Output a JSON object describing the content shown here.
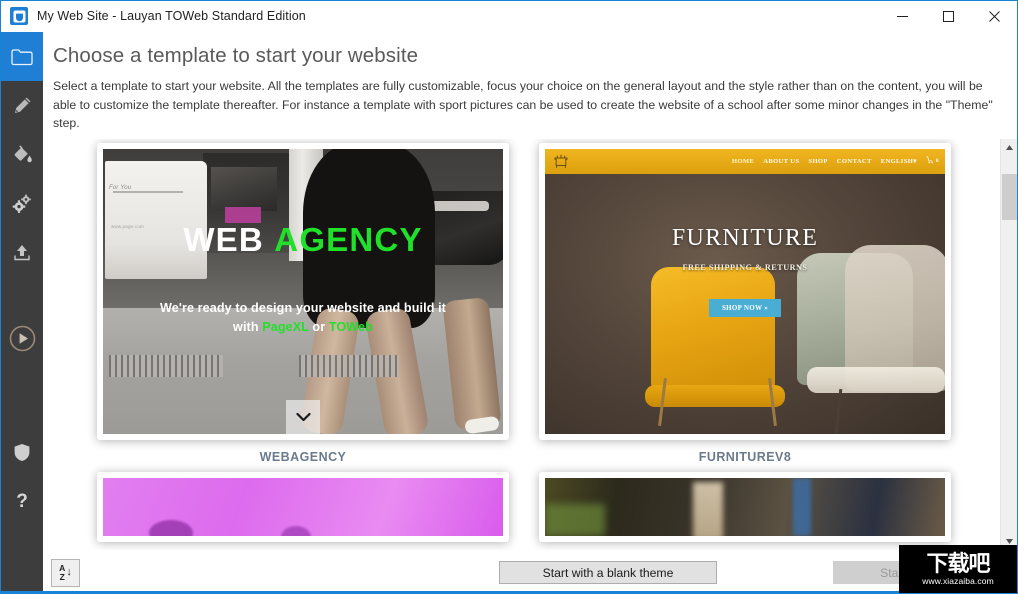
{
  "window": {
    "title": "My Web Site - Lauyan TOWeb Standard Edition",
    "app_icon": "toweb-logo-icon",
    "accent_color": "#1883d7",
    "controls": {
      "minimize": "minimize-icon",
      "maximize": "maximize-icon",
      "close": "close-icon"
    }
  },
  "sidebar": {
    "background_color": "#3d3d3d",
    "active_color": "#1e7fd4",
    "items": [
      {
        "icon": "folder-icon",
        "name": "site",
        "active": true
      },
      {
        "icon": "pencil-icon",
        "name": "edit",
        "active": false
      },
      {
        "icon": "paint-bucket-icon",
        "name": "theme",
        "active": false
      },
      {
        "icon": "gears-icon",
        "name": "settings",
        "active": false
      },
      {
        "icon": "upload-icon",
        "name": "publish",
        "active": false
      },
      {
        "icon": "play-circle-icon",
        "name": "preview",
        "active": false
      },
      {
        "icon": "shield-icon",
        "name": "security",
        "active": false
      },
      {
        "icon": "question-mark-icon",
        "name": "help",
        "active": false
      }
    ]
  },
  "page": {
    "title": "Choose a template to start your website",
    "description": "Select a template to start your website. All the templates are fully customizable, focus your choice on the general layout and the style rather than on the content, you will be able to customize the template thereafter. For instance a template with sport pictures can be used to create the website of a school after some minor changes in the \"Theme\" step."
  },
  "templates": [
    {
      "label": "WEBAGENCY",
      "preview": {
        "title_part1": "WEB",
        "title_part2": "AGENCY",
        "tagline_line1": "We're ready to design your website and build it",
        "tagline_line2_pre": "with ",
        "tagline_link1": "PageXL",
        "tagline_line2_mid": " or ",
        "tagline_link2": "TOWeb",
        "scroll_icon": "chevron-down-icon",
        "accent_color": "#21e02a"
      }
    },
    {
      "label": "FURNITUREV8",
      "preview": {
        "logo_icon": "furniture-crest-icon",
        "nav": [
          "HOME",
          "ABOUT US",
          "SHOP",
          "CONTACT",
          "ENGLISH"
        ],
        "nav_dropdown_icon": "caret-down-icon",
        "cart_icon": "shopping-cart-icon",
        "cart_badge": "0",
        "title": "FURNITURE",
        "subtitle": "FREE SHIPPING & RETURNS",
        "cta": "SHOP NOW »",
        "nav_color": "#e5a815",
        "cta_color": "#4aaed4"
      }
    },
    {
      "label": "",
      "preview": {
        "kind": "pink-partial"
      }
    },
    {
      "label": "",
      "preview": {
        "kind": "dark-partial"
      }
    }
  ],
  "scrollbar": {
    "up_icon": "scroll-up-arrow-icon",
    "down_icon": "scroll-down-arrow-icon"
  },
  "footer": {
    "sort_button": {
      "name": "sort-alphabetical-button",
      "letter_top": "A",
      "letter_bottom": "Z",
      "arrow": "↓"
    },
    "blank_theme_label": "Start with a blank theme",
    "start_label": "Start",
    "start_enabled": false
  },
  "watermark": {
    "text_cn": "下载吧",
    "url": "www.xiazaiba.com"
  }
}
